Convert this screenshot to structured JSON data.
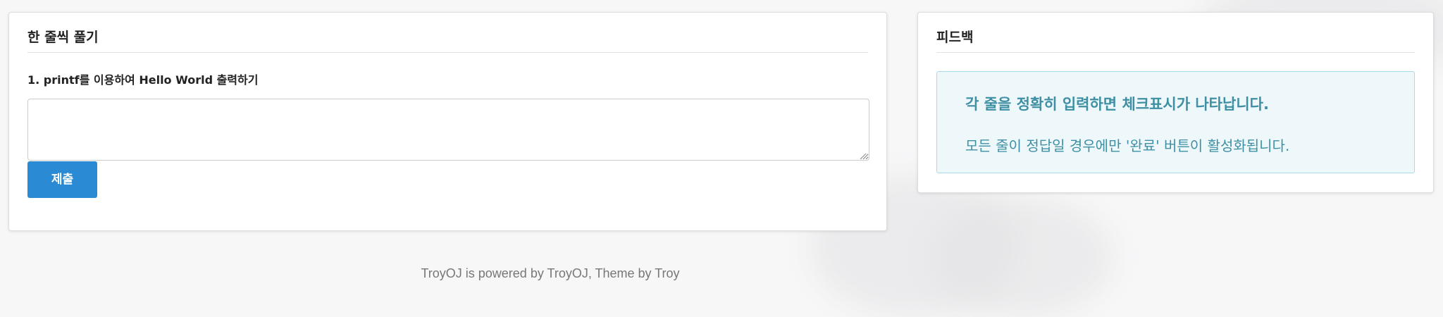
{
  "left_panel": {
    "title": "한 줄씩 풀기",
    "question": "1. printf를 이용하여 Hello World 출력하기",
    "answer_value": "",
    "submit_label": "제출"
  },
  "right_panel": {
    "title": "피드백",
    "alert_heading": "각 줄을 정확히 입력하면 체크표시가 나타납니다.",
    "alert_text": "모든 줄이 정답일 경우에만 '완료' 버튼이 활성화됩니다."
  },
  "footer": {
    "text": "TroyOJ is powered by TroyOJ, Theme by Troy"
  },
  "colors": {
    "primary_button": "#2b8ad4",
    "alert_text": "#3f8fa4",
    "alert_background": "#eef8fb",
    "alert_border": "#a9dbe5"
  },
  "icons": [
    "resize-grip-icon"
  ]
}
